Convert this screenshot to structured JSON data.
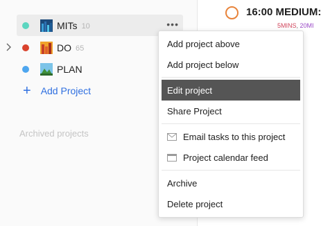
{
  "sidebar": {
    "projects": [
      {
        "name": "MITs",
        "count": "10",
        "dot_color": "#5cd6c0"
      },
      {
        "name": "DO",
        "count": "65",
        "dot_color": "#d9432e"
      },
      {
        "name": "PLAN",
        "count": "",
        "dot_color": "#4ea6ef"
      }
    ],
    "add_project_label": "Add Project",
    "archived_label": "Archived projects",
    "more_label": "•••"
  },
  "task": {
    "time": "16:00 MEDIUM:",
    "tag_a": "5MINS",
    "sep": ", ",
    "tag_b": "20MI"
  },
  "menu": {
    "items": [
      {
        "label": "Add project above"
      },
      {
        "label": "Add project below"
      },
      {
        "label": "Edit project"
      },
      {
        "label": "Share Project"
      },
      {
        "label": "Email tasks to this project",
        "icon": "email-icon"
      },
      {
        "label": "Project calendar feed",
        "icon": "calendar-icon"
      },
      {
        "label": "Archive"
      },
      {
        "label": "Delete project"
      }
    ],
    "active_item": "Edit project"
  },
  "colors": {
    "accent_blue": "#2f6fe0",
    "task_ring_orange": "#e8833a",
    "menu_active_bg": "#555555"
  }
}
